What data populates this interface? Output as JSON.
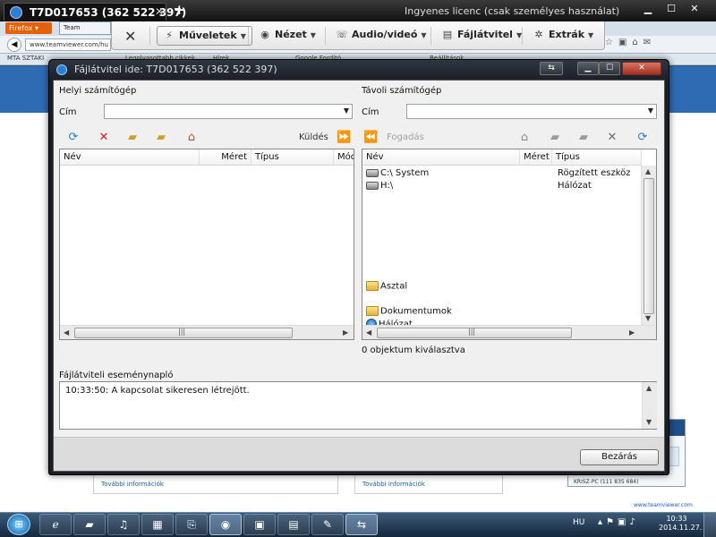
{
  "session_tab": {
    "title": "T7D017653 (362 522 397)",
    "close": "✕",
    "new_tab": "+"
  },
  "license_text": "Ingyenes licenc (csak személyes használat)",
  "browser": {
    "menu_button": "Firefox ▾",
    "tab_label": "Team",
    "url": "www.teamviewer.com/hu",
    "bookmarks": [
      "MTA SZTAKI",
      "Legolvasottabb cikkek",
      "Hírek",
      "Google Fordító",
      "Beállítások"
    ]
  },
  "toolbar": {
    "close": "✕",
    "items": [
      {
        "label": "Műveletek",
        "icon": "⚡"
      },
      {
        "label": "Nézet",
        "icon": "◉"
      },
      {
        "label": "Audio/videó",
        "icon": "☏"
      },
      {
        "label": "Fájlátvitel",
        "icon": "▤"
      },
      {
        "label": "Extrák",
        "icon": "✲"
      }
    ]
  },
  "window": {
    "title": "Fájlátvitel ide: T7D017653 (362 522 397)",
    "buttons": {
      "minimize": "▁",
      "maximize": "☐",
      "close": "✕"
    }
  },
  "local": {
    "title": "Helyi számítógép",
    "address_label": "Cím",
    "address_value": "",
    "send_label": "Küldés",
    "columns": [
      "Név",
      "Méret",
      "Típus",
      "Mód"
    ],
    "rows": []
  },
  "remote": {
    "title": "Távoli számítógép",
    "address_label": "Cím",
    "address_value": "",
    "receive_label": "Fogadás",
    "columns": [
      "Név",
      "Méret",
      "Típus"
    ],
    "rows": [
      {
        "name": "C:\\ System",
        "size": "",
        "type": "Rögzített eszköz",
        "icon": "drive-icon"
      },
      {
        "name": "H:\\",
        "size": "",
        "type": "Hálózat",
        "icon": "network-drive-icon"
      },
      {
        "name": "Asztal",
        "size": "",
        "type": "",
        "icon": "folder-icon"
      },
      {
        "name": "Dokumentumok",
        "size": "",
        "type": "",
        "icon": "folder-icon"
      },
      {
        "name": "Hálózat",
        "size": "",
        "type": "",
        "icon": "network-icon"
      }
    ],
    "selection_status": "0 objektum kiválasztva"
  },
  "log": {
    "title": "Fájlátviteli eseménynapló",
    "lines": [
      "10:33:50: A kapcsolat sikeresen létrejött."
    ]
  },
  "close_button": "Bezárás",
  "web": {
    "more_info": "További információk",
    "notif_text": "KRISZ-PC (111 835 684)",
    "notif_link": "www.teamviewer.com"
  },
  "taskbar": {
    "start": "⊞",
    "lang": "HU",
    "time": "10:33",
    "date": "2014.11.27."
  }
}
